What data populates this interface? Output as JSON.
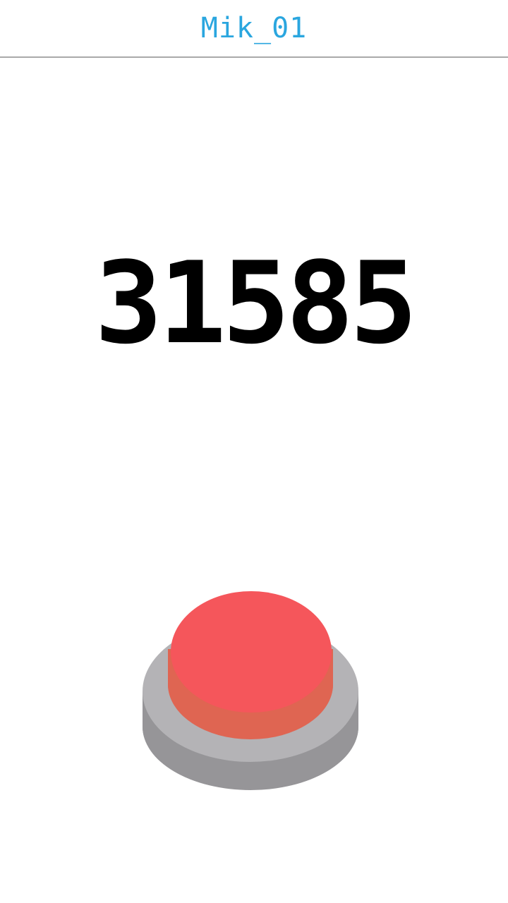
{
  "header": {
    "title": "Mik_01"
  },
  "counter": {
    "value": "31585"
  },
  "button": {
    "icon": "red-push-button-icon",
    "colors": {
      "base_light": "#b4b3b6",
      "base_dark": "#969598",
      "cap_top": "#f5565b",
      "cap_side": "#df6552"
    }
  }
}
